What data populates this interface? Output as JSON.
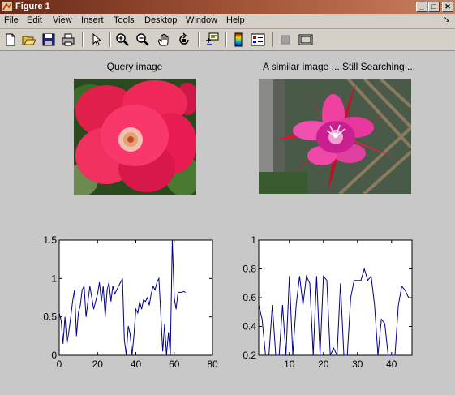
{
  "window": {
    "title": "Figure 1",
    "min_glyph": "_",
    "max_glyph": "□",
    "close_glyph": "✕"
  },
  "menu": {
    "items": [
      "File",
      "Edit",
      "View",
      "Insert",
      "Tools",
      "Desktop",
      "Window",
      "Help"
    ],
    "corner_glyph": "↘"
  },
  "toolbar": {
    "icons": [
      "new-figure-icon",
      "open-file-icon",
      "save-icon",
      "print-icon",
      "select-arrow-icon",
      "zoom-in-icon",
      "zoom-out-icon",
      "pan-hand-icon",
      "rotate-3d-icon",
      "data-cursor-icon",
      "insert-colorbar-icon",
      "insert-legend-icon",
      "hide-plot-tools-icon",
      "show-plot-tools-icon"
    ]
  },
  "images": {
    "query_title": "Query image",
    "similar_title": "A similar image ... Still Searching ...",
    "query_photo": "red-rose-flower-photo",
    "similar_photo": "pink-cactus-flower-photo"
  },
  "colors": {
    "line": "#00008b",
    "titlebar": "#8a4028",
    "window_bg": "#c8c8c8"
  },
  "chart_data": [
    {
      "type": "line",
      "title": "",
      "xlabel": "",
      "ylabel": "",
      "xlim": [
        0,
        80
      ],
      "ylim": [
        0,
        1.5
      ],
      "xticks": [
        0,
        20,
        40,
        60,
        80
      ],
      "yticks": [
        0,
        0.5,
        1,
        1.5
      ],
      "yticklabels": [
        "0",
        "0.5",
        "1",
        "1.5"
      ],
      "grid": false,
      "series": [
        {
          "values": [
            0.55,
            0.45,
            0.15,
            0.5,
            0.15,
            0.3,
            0.5,
            0.7,
            0.85,
            0.25,
            0.55,
            0.65,
            0.85,
            0.9,
            0.5,
            0.7,
            0.9,
            0.75,
            0.6,
            0.7,
            0.8,
            0.95,
            0.7,
            0.9,
            0.5,
            0.85,
            0.95,
            0.7,
            0.9,
            0.8,
            0.85,
            0.9,
            0.95,
            1.0,
            0.2,
            0.0,
            0.38,
            0.28,
            0.0,
            0.25,
            0.6,
            0.55,
            0.7,
            0.6,
            0.72,
            0.7,
            0.75,
            0.65,
            0.8,
            0.9,
            0.85,
            0.95,
            1.0,
            0.55,
            0.05,
            0.4,
            0.0,
            0.3,
            0.0,
            1.5,
            0.75,
            0.6,
            0.82,
            0.82,
            0.82,
            0.83,
            0.82
          ]
        }
      ]
    },
    {
      "type": "line",
      "title": "",
      "xlabel": "",
      "ylabel": "",
      "xlim": [
        1,
        46
      ],
      "ylim": [
        0.2,
        1
      ],
      "xticks": [
        10,
        20,
        30,
        40
      ],
      "yticks": [
        0.2,
        0.4,
        0.6,
        0.8,
        1
      ],
      "yticklabels": [
        "0.2",
        "0.4",
        "0.6",
        "0.8",
        "1"
      ],
      "grid": false,
      "series": [
        {
          "values": [
            0.55,
            0.45,
            0.2,
            0.2,
            0.55,
            0.2,
            0.2,
            0.55,
            0.2,
            0.75,
            0.2,
            0.55,
            0.75,
            0.55,
            0.75,
            0.7,
            0.2,
            0.75,
            0.2,
            0.75,
            0.72,
            0.2,
            0.25,
            0.2,
            0.7,
            0.2,
            0.2,
            0.6,
            0.72,
            0.72,
            0.72,
            0.8,
            0.72,
            0.75,
            0.55,
            0.2,
            0.45,
            0.42,
            0.2,
            0.2,
            0.2,
            0.55,
            0.68,
            0.65,
            0.6
          ]
        }
      ]
    }
  ]
}
